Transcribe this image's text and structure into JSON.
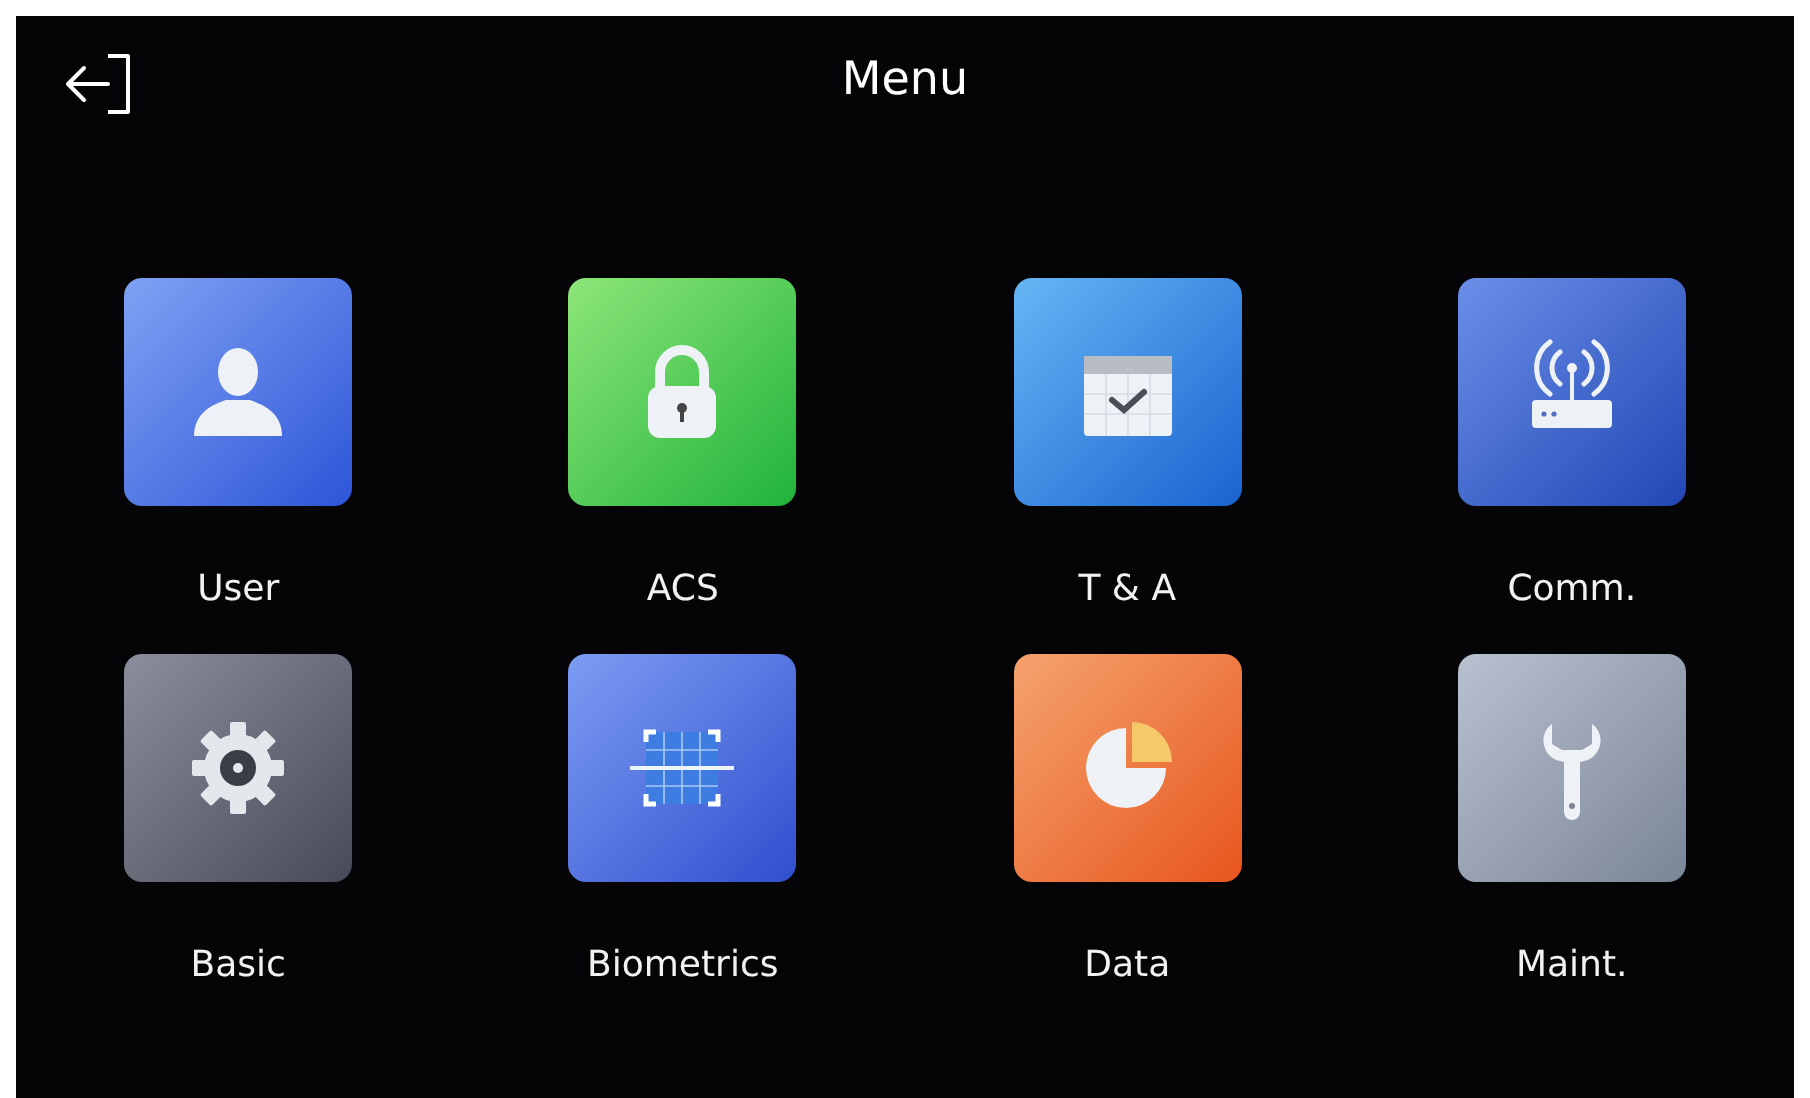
{
  "header": {
    "title": "Menu"
  },
  "items": [
    {
      "label": "User",
      "kind": "user"
    },
    {
      "label": "ACS",
      "kind": "lock"
    },
    {
      "label": "T & A",
      "kind": "calendar"
    },
    {
      "label": "Comm.",
      "kind": "router"
    },
    {
      "label": "Basic",
      "kind": "gear"
    },
    {
      "label": "Biometrics",
      "kind": "scan"
    },
    {
      "label": "Data",
      "kind": "pie"
    },
    {
      "label": "Maint.",
      "kind": "wrench"
    }
  ]
}
